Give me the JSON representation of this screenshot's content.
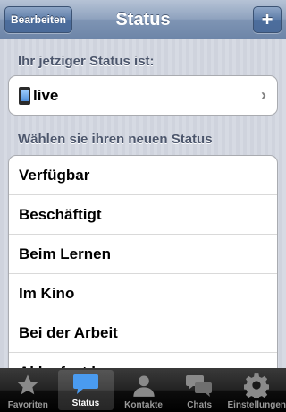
{
  "navbar": {
    "title": "Status",
    "edit_label": "Bearbeiten",
    "add_label": "+"
  },
  "current": {
    "header": "Ihr jetziger Status ist:",
    "status": "live",
    "icon": "phone-icon"
  },
  "choose": {
    "header": "Wählen sie ihren neuen Status",
    "options": [
      "Verfügbar",
      "Beschäftigt",
      "Beim Lernen",
      "Im Kino",
      "Bei der Arbeit",
      "Akku fast leer"
    ]
  },
  "tabbar": {
    "tabs": [
      {
        "label": "Favoriten",
        "icon": "star-icon"
      },
      {
        "label": "Status",
        "icon": "speech-bubble-icon",
        "active": true
      },
      {
        "label": "Kontakte",
        "icon": "person-icon"
      },
      {
        "label": "Chats",
        "icon": "chat-bubbles-icon"
      },
      {
        "label": "Einstellungen",
        "icon": "gear-icon"
      }
    ]
  },
  "colors": {
    "navbar": "#7f95b4",
    "section_text": "#4c566c",
    "tab_active_icon": "#4a9bf0"
  }
}
